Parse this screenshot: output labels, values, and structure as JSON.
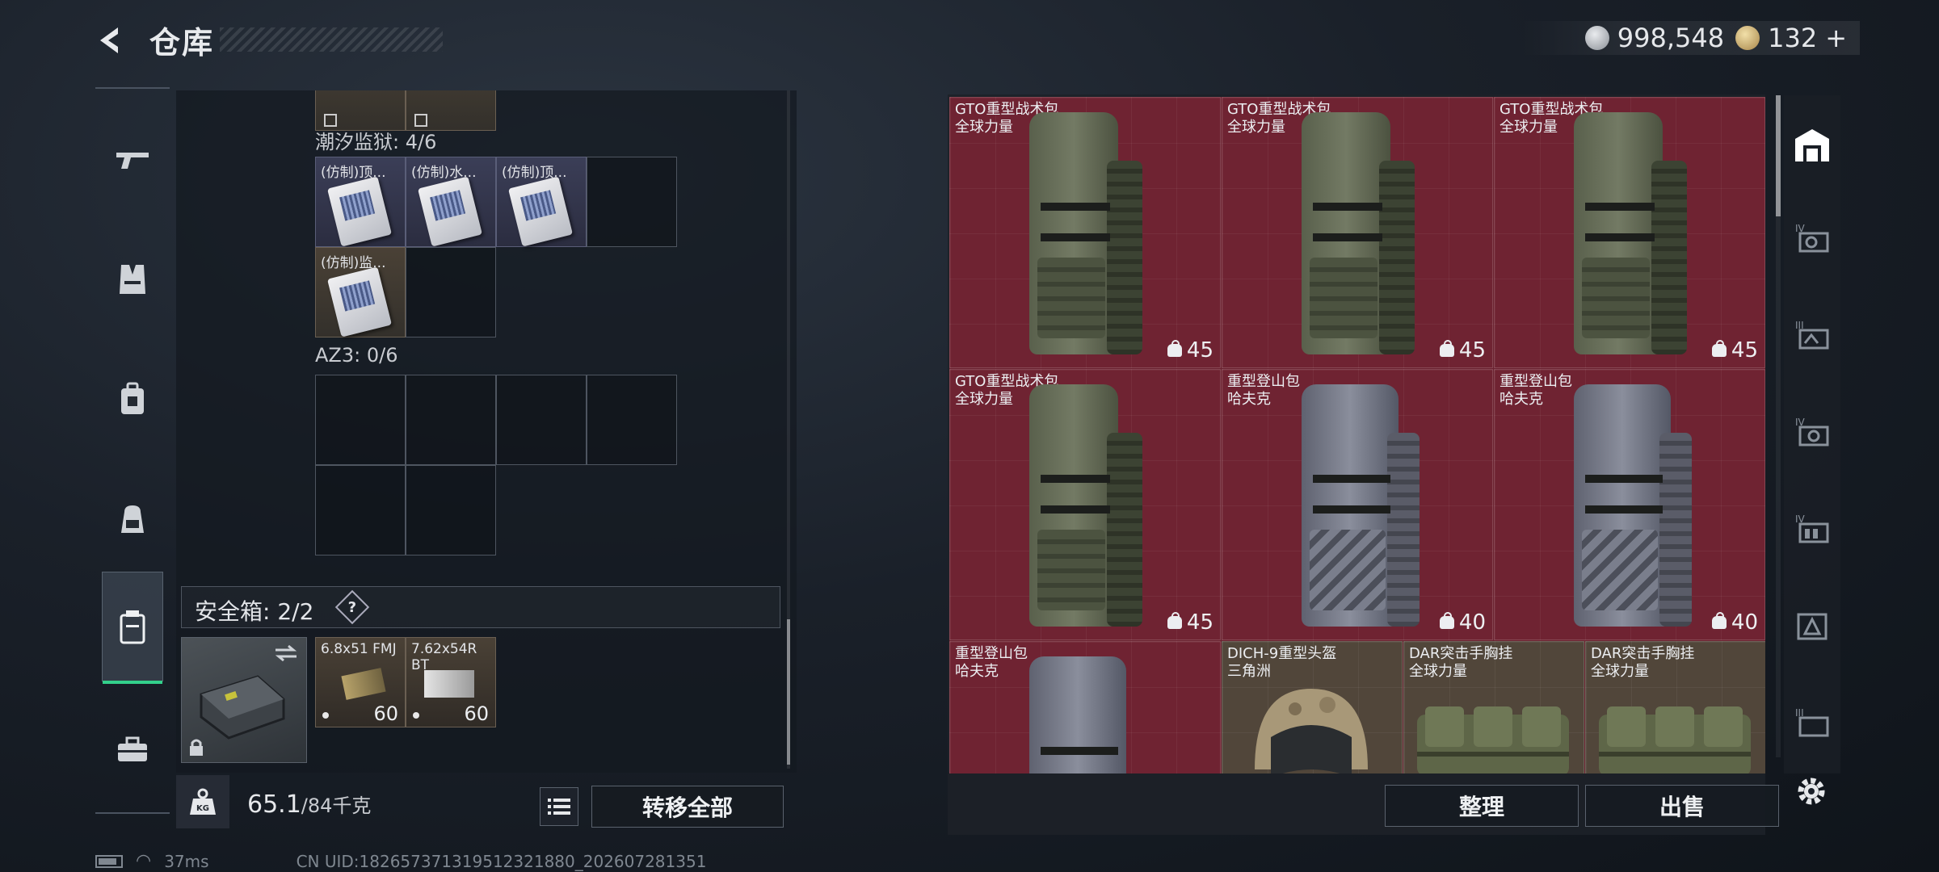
{
  "header": {
    "title": "仓库"
  },
  "currency": {
    "coins": "998,548",
    "premium": "132",
    "add_label": "+"
  },
  "left_panel": {
    "sections": [
      {
        "label": "潮汐监狱: 4/6",
        "items": [
          "(仿制)顶...",
          "(仿制)水...",
          "(仿制)顶...",
          "(仿制)监..."
        ]
      },
      {
        "label": "AZ3: 0/6"
      }
    ],
    "safe_box": {
      "title": "安全箱: 2/2",
      "help": "?",
      "ammo": [
        {
          "name": "6.8x51 FMJ",
          "count": "60"
        },
        {
          "name": "7.62x54R BT",
          "count": "60"
        }
      ]
    },
    "weight": {
      "value": "65.1",
      "max": "/84千克"
    },
    "transfer_all": "转移全部"
  },
  "storage": {
    "items": [
      {
        "name": "GTO重型战术包",
        "brand": "全球力量",
        "count": "45"
      },
      {
        "name": "GTO重型战术包",
        "brand": "全球力量",
        "count": "45"
      },
      {
        "name": "GTO重型战术包",
        "brand": "全球力量",
        "count": "45"
      },
      {
        "name": "GTO重型战术包",
        "brand": "全球力量",
        "count": "45"
      },
      {
        "name": "重型登山包",
        "brand": "哈夫克",
        "count": "40"
      },
      {
        "name": "重型登山包",
        "brand": "哈夫克",
        "count": "40"
      },
      {
        "name": "重型登山包",
        "brand": "哈夫克"
      },
      {
        "name": "DICH-9重型头盔",
        "brand": "三角洲"
      },
      {
        "name": "DAR突击手胸挂",
        "brand": "全球力量"
      },
      {
        "name": "DAR突击手胸挂",
        "brand": "全球力量"
      }
    ],
    "sort_label": "整理",
    "sell_label": "出售"
  },
  "status_bar": {
    "ping": "37ms",
    "uid": "CN UID:18265737131951232188​0_202607281351"
  },
  "colors": {
    "accent_green": "#33d08b",
    "item_red": "#6f2332",
    "item_brown": "#51463a"
  }
}
